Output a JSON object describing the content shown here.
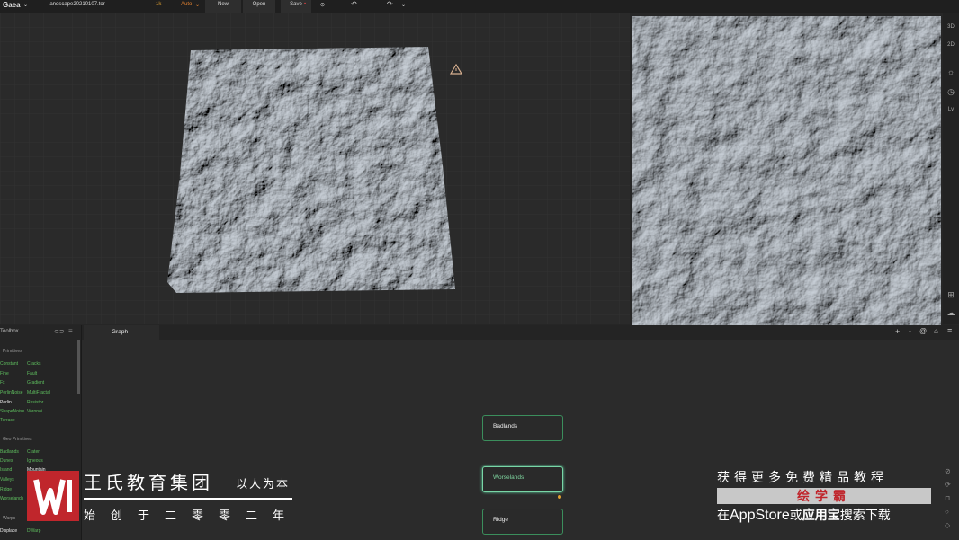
{
  "topbar": {
    "app_name": "Gaea",
    "file_name": "landscape20210107.tor",
    "resolution": "1k",
    "build_mode": "Auto",
    "new_label": "New",
    "open_label": "Open",
    "save_label": "Save"
  },
  "right_strip": {
    "btn_3d": "3D",
    "btn_2d": "2D",
    "btn_lv": "Lv"
  },
  "toolbox": {
    "title": "Toolbox",
    "sections": [
      {
        "title": "Primitives",
        "items": [
          [
            "Constant",
            "Cracks"
          ],
          [
            "Fine",
            "Fault"
          ],
          [
            "Fx",
            "Gradient"
          ],
          [
            "PerlinNoise",
            "MultiFractal"
          ],
          [
            "Perlin",
            "Resistor"
          ],
          [
            "ShapeNoise",
            "Voronoi"
          ],
          [
            "Terrace",
            ""
          ]
        ]
      },
      {
        "title": "Geo Primitives",
        "items": [
          [
            "Badlands",
            "Crater"
          ],
          [
            "Dunes",
            "Igneous"
          ],
          [
            "Island",
            "Mountain"
          ],
          [
            "Valleys",
            ""
          ],
          [
            "Ridge",
            ""
          ],
          [
            "Worselands",
            ""
          ]
        ]
      },
      {
        "title": "Warps",
        "items": [
          [
            "Displace",
            "DWarp"
          ]
        ]
      }
    ]
  },
  "graph": {
    "tab_label": "Graph",
    "nodes": [
      "Badlands",
      "Worselands",
      "Ridge"
    ]
  },
  "watermark": {
    "org_name": "王氏教育集团",
    "slogan": "以人为本",
    "founded": "始创于二零零二年",
    "promo_line1": "获得更多免费精品教程",
    "promo_brand": "绘学霸",
    "promo_line3_prefix": "在",
    "promo_appstore": "AppStore",
    "promo_or": "或",
    "promo_yyb": "应用宝",
    "promo_suffix": "搜索下载"
  }
}
